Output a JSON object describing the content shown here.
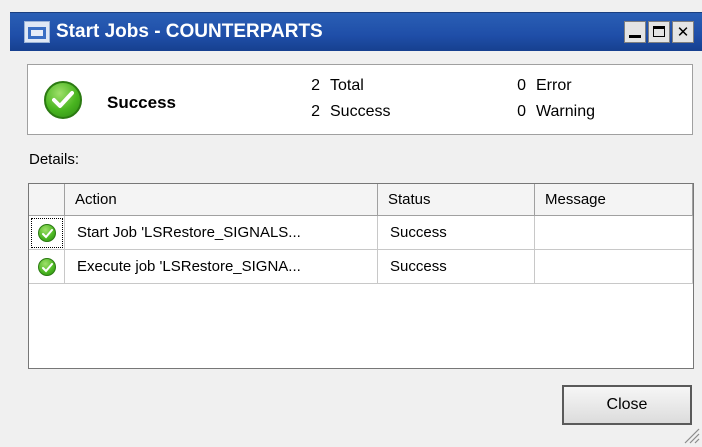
{
  "window": {
    "title": "Start Jobs - COUNTERPARTS",
    "title_bar_color": "#1f4ea8",
    "app_icon": "dialog-window-icon",
    "controls": [
      "minimize-icon",
      "maximize-icon",
      "close-icon"
    ],
    "close_glyph": "✕"
  },
  "summary": {
    "status_icon": "success-check-icon",
    "status_label": "Success",
    "total_count": "2",
    "total_label": "Total",
    "success_count": "2",
    "success_label": "Success",
    "error_count": "0",
    "error_label": "Error",
    "warning_count": "0",
    "warning_label": "Warning"
  },
  "details": {
    "label": "Details:",
    "columns": [
      "Action",
      "Status",
      "Message"
    ],
    "rows": [
      {
        "icon": "success-check-icon",
        "action": "Start Job 'LSRestore_SIGNALS...",
        "status": "Success",
        "message": ""
      },
      {
        "icon": "success-check-icon",
        "action": "Execute job 'LSRestore_SIGNA...",
        "status": "Success",
        "message": ""
      }
    ]
  },
  "footer": {
    "close_label": "Close"
  }
}
